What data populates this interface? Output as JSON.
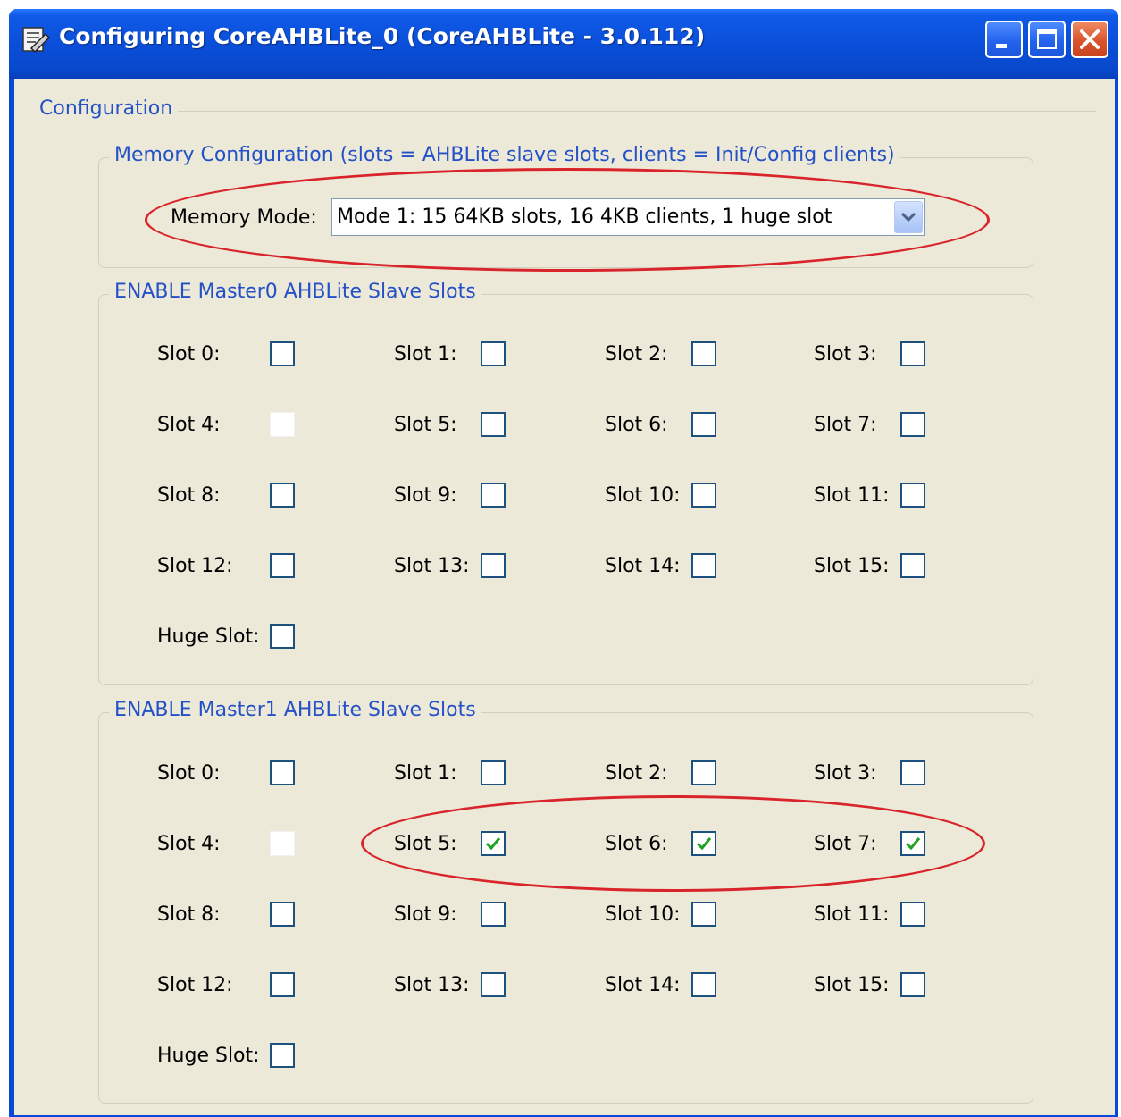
{
  "window": {
    "title": "Configuring CoreAHBLite_0 (CoreAHBLite - 3.0.112)"
  },
  "configuration": {
    "title": "Configuration"
  },
  "memory": {
    "title": "Memory Configuration (slots = AHBLite slave slots, clients = Init/Config clients)",
    "mode_label": "Memory Mode:",
    "mode_value": "Mode 1: 15 64KB slots, 16 4KB clients, 1 huge slot"
  },
  "master0": {
    "title": "ENABLE Master0 AHBLite Slave Slots",
    "slots": [
      {
        "label": "Slot 0:",
        "checked": false
      },
      {
        "label": "Slot 1:",
        "checked": false
      },
      {
        "label": "Slot 2:",
        "checked": false
      },
      {
        "label": "Slot 3:",
        "checked": false
      },
      {
        "label": "Slot 4:",
        "checked": false,
        "disabled": true
      },
      {
        "label": "Slot 5:",
        "checked": false
      },
      {
        "label": "Slot 6:",
        "checked": false
      },
      {
        "label": "Slot 7:",
        "checked": false
      },
      {
        "label": "Slot 8:",
        "checked": false
      },
      {
        "label": "Slot 9:",
        "checked": false
      },
      {
        "label": "Slot 10:",
        "checked": false
      },
      {
        "label": "Slot 11:",
        "checked": false
      },
      {
        "label": "Slot 12:",
        "checked": false
      },
      {
        "label": "Slot 13:",
        "checked": false
      },
      {
        "label": "Slot 14:",
        "checked": false
      },
      {
        "label": "Slot 15:",
        "checked": false
      },
      {
        "label": "Huge Slot:",
        "checked": false
      }
    ]
  },
  "master1": {
    "title": "ENABLE Master1 AHBLite Slave Slots",
    "slots": [
      {
        "label": "Slot 0:",
        "checked": false
      },
      {
        "label": "Slot 1:",
        "checked": false
      },
      {
        "label": "Slot 2:",
        "checked": false
      },
      {
        "label": "Slot 3:",
        "checked": false
      },
      {
        "label": "Slot 4:",
        "checked": false,
        "disabled": true
      },
      {
        "label": "Slot 5:",
        "checked": true
      },
      {
        "label": "Slot 6:",
        "checked": true
      },
      {
        "label": "Slot 7:",
        "checked": true
      },
      {
        "label": "Slot 8:",
        "checked": false
      },
      {
        "label": "Slot 9:",
        "checked": false
      },
      {
        "label": "Slot 10:",
        "checked": false
      },
      {
        "label": "Slot 11:",
        "checked": false
      },
      {
        "label": "Slot 12:",
        "checked": false
      },
      {
        "label": "Slot 13:",
        "checked": false
      },
      {
        "label": "Slot 14:",
        "checked": false
      },
      {
        "label": "Slot 15:",
        "checked": false
      },
      {
        "label": "Huge Slot:",
        "checked": false
      }
    ]
  },
  "colors": {
    "titlebar": "#0a4fd9",
    "client_bg": "#ece9d8",
    "group_title": "#2450c8",
    "highlight_oval": "#d8242a",
    "checkmark": "#21a121"
  }
}
